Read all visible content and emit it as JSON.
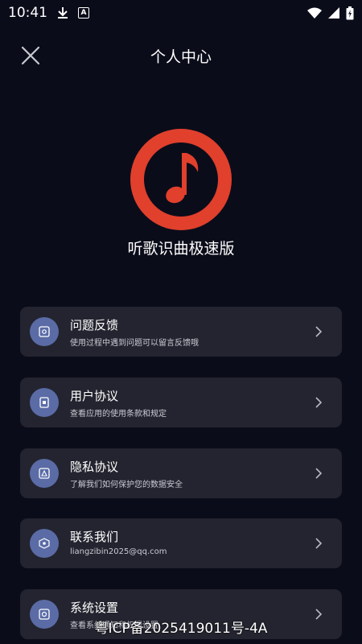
{
  "statusbar": {
    "time": "10:41"
  },
  "header": {
    "title": "个人中心"
  },
  "app": {
    "name": "听歌识曲极速版"
  },
  "menu": [
    {
      "title": "问题反馈",
      "subtitle": "使用过程中遇到问题可以留言反馈哦"
    },
    {
      "title": "用户协议",
      "subtitle": "查看应用的使用条款和规定"
    },
    {
      "title": "隐私协议",
      "subtitle": "了解我们如何保护您的数据安全"
    },
    {
      "title": "联系我们",
      "subtitle": "liangzibin2025@qq.com"
    },
    {
      "title": "系统设置",
      "subtitle": "查看系统通知和权限设置"
    }
  ],
  "footer": {
    "icp": "粤ICP备2025419011号-4A"
  },
  "colors": {
    "background": "#0b0c1a",
    "card": "#23242f",
    "icon_circle": "#5a6ba6",
    "logo_red": "#e0402c"
  }
}
